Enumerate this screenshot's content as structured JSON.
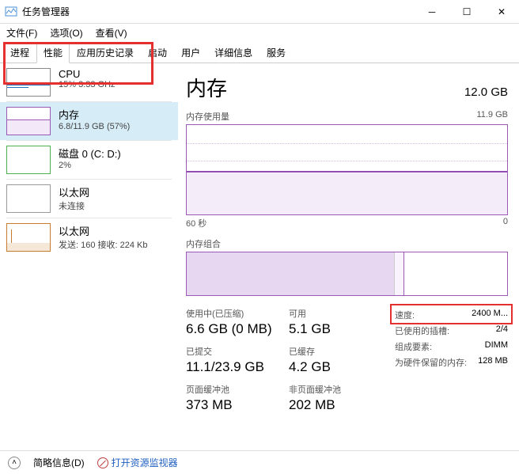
{
  "window": {
    "title": "任务管理器"
  },
  "menubar": {
    "file": "文件(F)",
    "options": "选项(O)",
    "view": "查看(V)"
  },
  "tabs": [
    "进程",
    "性能",
    "应用历史记录",
    "启动",
    "用户",
    "详细信息",
    "服务"
  ],
  "active_tab": "性能",
  "sidebar": {
    "items": [
      {
        "name": "CPU",
        "sub": "15% 3.33 GHz"
      },
      {
        "name": "内存",
        "sub": "6.8/11.9 GB (57%)"
      },
      {
        "name": "磁盘 0 (C: D:)",
        "sub": "2%"
      },
      {
        "name": "以太网",
        "sub": "未连接"
      },
      {
        "name": "以太网",
        "sub": "发送: 160 接收: 224 Kb"
      }
    ]
  },
  "content": {
    "title": "内存",
    "capacity": "12.0 GB",
    "chart_usage_label": "内存使用量",
    "chart_max": "11.9 GB",
    "xaxis_left": "60 秒",
    "xaxis_right": "0",
    "comp_label": "内存组合",
    "stats": {
      "in_use_label": "使用中(已压缩)",
      "in_use_value": "6.6 GB (0 MB)",
      "avail_label": "可用",
      "avail_value": "5.1 GB",
      "committed_label": "已提交",
      "committed_value": "11.1/23.9 GB",
      "cached_label": "已缓存",
      "cached_value": "4.2 GB",
      "paged_label": "页面缓冲池",
      "paged_value": "373 MB",
      "nonpaged_label": "非页面缓冲池",
      "nonpaged_value": "202 MB"
    },
    "right": {
      "speed_k": "速度:",
      "speed_v": "2400 M...",
      "slots_k": "已使用的插槽:",
      "slots_v": "2/4",
      "form_k": "组成要素:",
      "form_v": "DIMM",
      "reserved_k": "为硬件保留的内存:",
      "reserved_v": "128 MB"
    }
  },
  "footer": {
    "simple": "简略信息(D)",
    "resmon": "打开资源监视器"
  },
  "chart_data": {
    "type": "line",
    "title": "内存使用量",
    "ylabel": "GB",
    "ylim": [
      0,
      11.9
    ],
    "xlabel": "秒",
    "xlim": [
      60,
      0
    ],
    "series": [
      {
        "name": "使用中",
        "approx_values": [
          6.2,
          6.2,
          6.2,
          6.2,
          6.2,
          6.2,
          6.2,
          6.2,
          6.2,
          6.2
        ]
      }
    ],
    "composition": {
      "in_use_pct": 65,
      "modified_pct": 3,
      "free_pct": 32
    }
  }
}
